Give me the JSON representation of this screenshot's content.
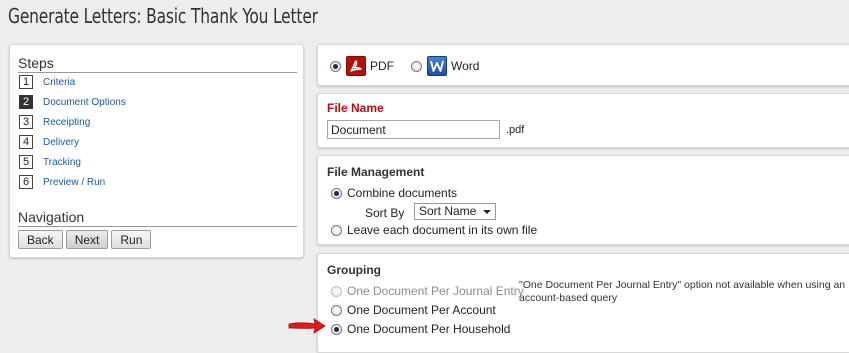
{
  "page": {
    "title": "Generate Letters: Basic Thank You Letter"
  },
  "steps": {
    "heading": "Steps",
    "items": [
      {
        "number": "1",
        "label": "Criteria",
        "active": false
      },
      {
        "number": "2",
        "label": "Document Options",
        "active": true
      },
      {
        "number": "3",
        "label": "Receipting",
        "active": false
      },
      {
        "number": "4",
        "label": "Delivery",
        "active": false
      },
      {
        "number": "5",
        "label": "Tracking",
        "active": false
      },
      {
        "number": "6",
        "label": "Preview / Run",
        "active": false
      }
    ]
  },
  "navigation": {
    "heading": "Navigation",
    "back_label": "Back",
    "next_label": "Next",
    "run_label": "Run"
  },
  "format": {
    "selected": "PDF",
    "options": [
      {
        "label": "PDF",
        "icon": "pdf-icon",
        "color": "#b3110d"
      },
      {
        "label": "Word",
        "icon": "word-icon",
        "color": "#2a5db0"
      }
    ]
  },
  "file_name": {
    "title": "File Name",
    "value": "Document",
    "suffix": ".pdf"
  },
  "file_management": {
    "title": "File Management",
    "combine_label": "Combine documents",
    "sort_by_label": "Sort By",
    "sort_by_value": "Sort Name",
    "separate_label": "Leave each document in its own file",
    "selected": "Combine documents"
  },
  "grouping": {
    "title": "Grouping",
    "options": [
      {
        "label": "One Document Per Journal Entry",
        "disabled": true,
        "selected": false
      },
      {
        "label": "One Document Per Account",
        "disabled": false,
        "selected": false
      },
      {
        "label": "One Document Per Household",
        "disabled": false,
        "selected": true
      }
    ],
    "note": "\"One Document Per Journal Entry\" option not available when using an account-based query"
  },
  "colors": {
    "accent_red": "#b40f13",
    "link_blue": "#1d5a9a",
    "background": "#ededed"
  }
}
